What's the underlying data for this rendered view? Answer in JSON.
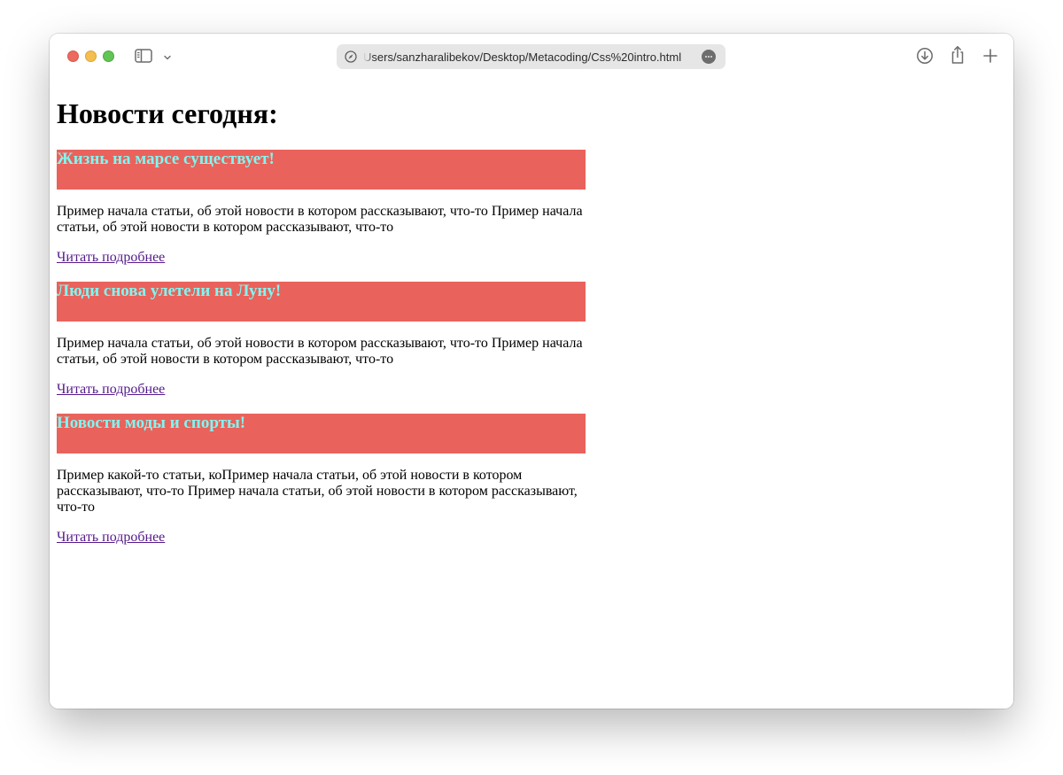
{
  "browser": {
    "url": "Users/sanzharalibekov/Desktop/Metacoding/Css%20intro.html",
    "icons": {
      "sidebar": "sidebar-icon",
      "chevron": "chevron-down-icon",
      "site_info": "compass-icon",
      "more": "ellipsis-icon",
      "downloads": "download-icon",
      "share": "share-icon",
      "new_tab": "plus-icon"
    },
    "traffic_lights": {
      "close": "#ec6a5e",
      "minimize": "#f4bf4f",
      "maximize": "#61c554"
    }
  },
  "page": {
    "title": "Новости сегодня:",
    "colors": {
      "heading_background": "#ea625c",
      "heading_text": "#7ff7f1",
      "visited_link": "#551a8b"
    },
    "articles": [
      {
        "heading": "Жизнь на марсе существует!",
        "text": "Пример начала статьи, об этой новости в котором рассказывают, что-то Пример начала статьи, об этой новости в котором рассказывают, что-то",
        "link": "Читать подробнее"
      },
      {
        "heading": "Люди снова улетели на Луну!",
        "text": "Пример начала статьи, об этой новости в котором рассказывают, что-то Пример начала статьи, об этой новости в котором рассказывают, что-то",
        "link": "Читать подробнее"
      },
      {
        "heading": "Новости моды и спорты!",
        "text": "Пример какой-то статьи, коПример начала статьи, об этой новости в котором рассказывают, что-то Пример начала статьи, об этой новости в котором рассказывают, что-то",
        "link": "Читать подробнее"
      }
    ]
  }
}
